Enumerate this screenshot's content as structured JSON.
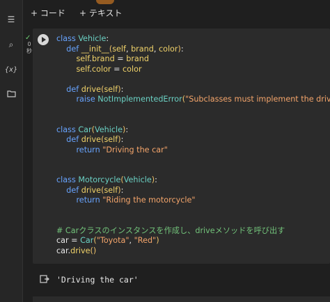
{
  "toolbar": {
    "add_code_label": "+ コード",
    "add_text_label": "+ テキスト"
  },
  "sidebar": {
    "items": [
      {
        "name": "table-of-contents-icon",
        "glyph": "☰"
      },
      {
        "name": "search-icon",
        "glyph": "⌕"
      },
      {
        "name": "variables-icon",
        "glyph": "{x}"
      },
      {
        "name": "files-icon",
        "glyph": "▭"
      }
    ]
  },
  "cell": {
    "status_check": "✓",
    "exec_time": [
      "0",
      "秒"
    ],
    "code_lines": [
      "class Vehicle:",
      "    def __init__(self, brand, color):",
      "        self.brand = brand",
      "        self.color = color",
      "",
      "    def drive(self):",
      "        raise NotImplementedError(\"Subclasses must implement the drive",
      "",
      "",
      "class Car(Vehicle):",
      "    def drive(self):",
      "        return \"Driving the car\"",
      "",
      "",
      "class Motorcycle(Vehicle):",
      "    def drive(self):",
      "        return \"Riding the motorcycle\"",
      "",
      "",
      "# Carクラスのインスタンスを作成し、driveメソッドを呼び出す",
      "car = Car(\"Toyota\", \"Red\")",
      "car.drive()"
    ]
  },
  "output": {
    "text": "'Driving the car'"
  }
}
